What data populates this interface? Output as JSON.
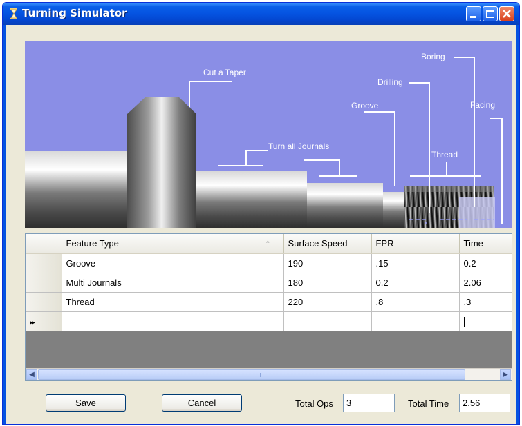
{
  "window": {
    "title": "Turning Simulator",
    "title_icon": "hourglass-icon",
    "controls": [
      "minimize-icon",
      "maximize-icon",
      "close-icon"
    ]
  },
  "diagram": {
    "labels": {
      "cut_taper": "Cut a Taper",
      "turn_journals": "Turn all Journals",
      "groove": "Groove",
      "drilling": "Drilling",
      "boring": "Boring",
      "facing": "Facing",
      "thread": "Thread"
    }
  },
  "grid": {
    "columns": [
      "Feature Type",
      "Surface Speed",
      "FPR",
      "Time"
    ],
    "sorted_column_indicator": "^",
    "new_row_indicator": "▸▸",
    "rows": [
      [
        "Groove",
        "190",
        ".15",
        "0.2"
      ],
      [
        "Multi Journals",
        "180",
        "0.2",
        "2.06"
      ],
      [
        "Thread",
        "220",
        ".8",
        ".3"
      ]
    ]
  },
  "footer": {
    "save_label": "Save",
    "cancel_label": "Cancel",
    "total_ops_label": "Total Ops",
    "total_ops_value": "3",
    "total_time_label": "Total Time",
    "total_time_value": "2.56"
  },
  "colors": {
    "titlebar": "#0553e1",
    "preview_background": "#8a8ee6",
    "window_face": "#ece9d8"
  }
}
